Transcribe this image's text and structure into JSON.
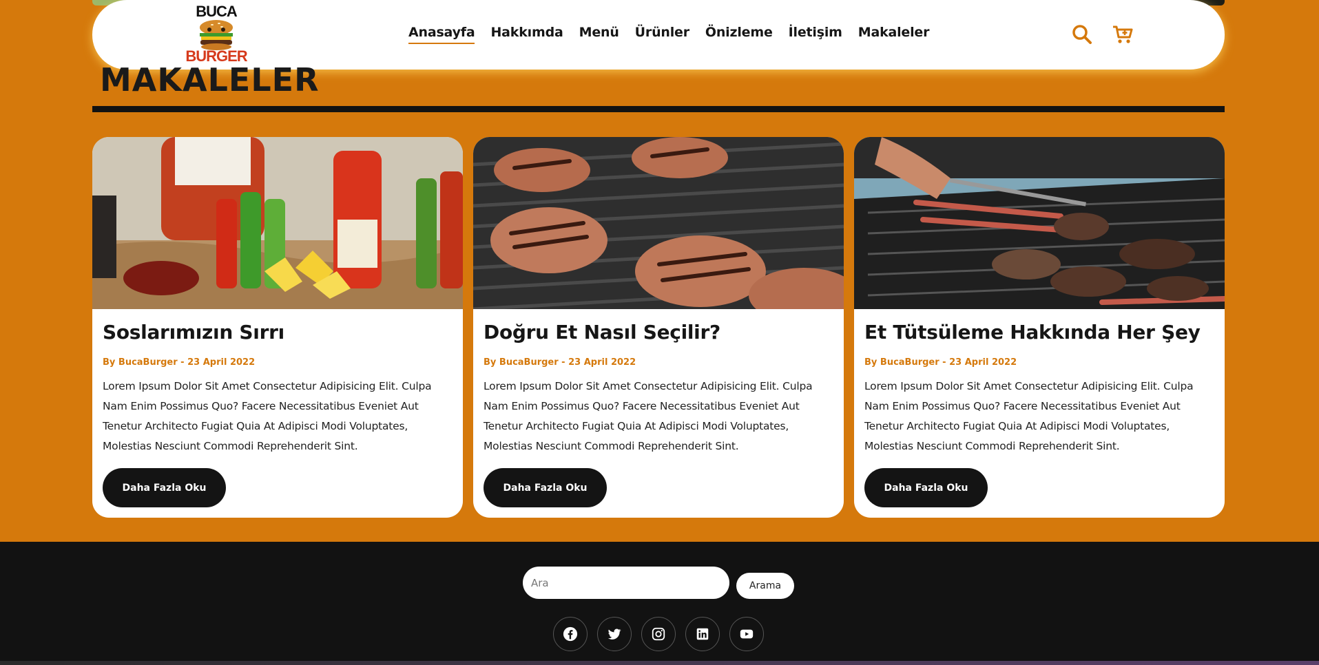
{
  "brand": {
    "line1": "BUCA",
    "line2": "BURGER"
  },
  "nav": {
    "items": [
      {
        "label": "Anasayfa",
        "active": true
      },
      {
        "label": "Hakkımda",
        "active": false
      },
      {
        "label": "Menü",
        "active": false
      },
      {
        "label": "Ürünler",
        "active": false
      },
      {
        "label": "Önizleme",
        "active": false
      },
      {
        "label": "İletişim",
        "active": false
      },
      {
        "label": "Makaleler",
        "active": false
      }
    ],
    "icons": [
      "search-icon",
      "cart-plus-icon"
    ]
  },
  "section": {
    "title": "MAKALELER"
  },
  "articles": [
    {
      "title": "Soslarımızın Sırrı",
      "meta": "By BucaBurger - 23 April 2022",
      "text": "Lorem Ipsum Dolor Sit Amet Consectetur Adipisicing Elit. Culpa Nam Enim Possimus Quo? Facere Necessitatibus Eveniet Aut Tenetur Architecto Fugiat Quia At Adipisci Modi Voluptates, Molestias Nesciunt Commodi Reprehenderit Sint.",
      "button": "Daha Fazla Oku"
    },
    {
      "title": "Doğru Et Nasıl Seçilir?",
      "meta": "By BucaBurger - 23 April 2022",
      "text": "Lorem Ipsum Dolor Sit Amet Consectetur Adipisicing Elit. Culpa Nam Enim Possimus Quo? Facere Necessitatibus Eveniet Aut Tenetur Architecto Fugiat Quia At Adipisci Modi Voluptates, Molestias Nesciunt Commodi Reprehenderit Sint.",
      "button": "Daha Fazla Oku"
    },
    {
      "title": "Et Tütsüleme Hakkında Her Şey",
      "meta": "By BucaBurger - 23 April 2022",
      "text": "Lorem Ipsum Dolor Sit Amet Consectetur Adipisicing Elit. Culpa Nam Enim Possimus Quo? Facere Necessitatibus Eveniet Aut Tenetur Architecto Fugiat Quia At Adipisci Modi Voluptates, Molestias Nesciunt Commodi Reprehenderit Sint.",
      "button": "Daha Fazla Oku"
    }
  ],
  "footer": {
    "search_placeholder": "Ara",
    "search_button": "Arama",
    "social_icons": [
      "facebook-icon",
      "twitter-icon",
      "instagram-icon",
      "linkedin-icon",
      "youtube-icon"
    ]
  },
  "colors": {
    "accent": "#d5790c",
    "dark": "#121212",
    "card": "#ffffff",
    "logo_red": "#d63a1c"
  }
}
